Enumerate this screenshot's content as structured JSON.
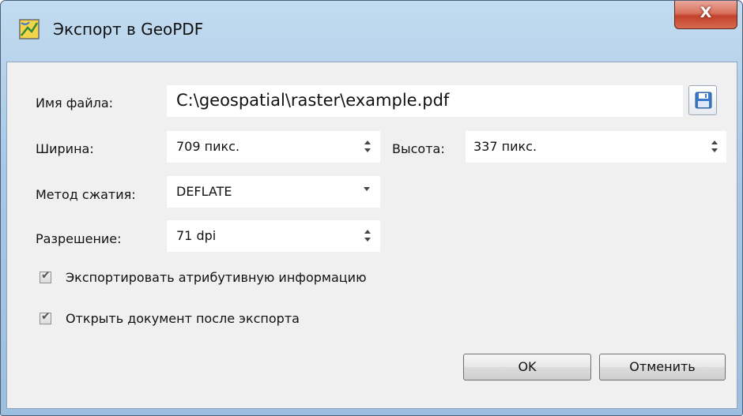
{
  "window": {
    "title": "Экспорт в GeoPDF",
    "close_symbol": "X"
  },
  "form": {
    "filename": {
      "label": "Имя файла:",
      "value": "C:\\geospatial\\raster\\example.pdf"
    },
    "width": {
      "label": "Ширина:",
      "value": "709 пикс."
    },
    "height": {
      "label": "Высота:",
      "value": "337 пикс."
    },
    "compression": {
      "label": "Метод сжатия:",
      "value": "DEFLATE"
    },
    "resolution": {
      "label": "Разрешение:",
      "value": "71 dpi"
    },
    "export_attributes": {
      "label": "Экспортировать атрибутивную информацию",
      "checked": true
    },
    "open_after": {
      "label": "Открыть документ после экспорта",
      "checked": true
    }
  },
  "buttons": {
    "ok": "OK",
    "cancel": "Отменить"
  },
  "icons": {
    "app": "geopdf-map-icon",
    "save": "floppy-disk-icon",
    "close": "close-icon"
  },
  "colors": {
    "titlebar": "#a9c8e6",
    "close_button": "#c2432b",
    "client_bg": "#f0f0f0"
  }
}
